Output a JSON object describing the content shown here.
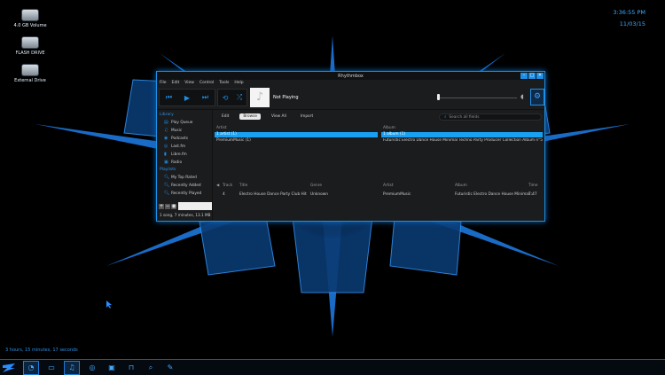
{
  "desktop": {
    "icons": [
      {
        "label": "4.0 GB Volume"
      },
      {
        "label": "FLASH DRIVE"
      },
      {
        "label": "External Drive"
      }
    ],
    "clock": {
      "time": "3:36:55 PM",
      "date": "11/03/15"
    },
    "uptime": "3 hours, 15 minutes, 17 seconds"
  },
  "taskbar": {
    "icons": [
      "start-logo-icon",
      "rhythmbox-icon",
      "monitor-icon",
      "music-icon",
      "settings-icon",
      "image-icon",
      "lock-icon",
      "search-icon",
      "tools-icon"
    ]
  },
  "window": {
    "title": "Rhythmbox",
    "controls": [
      "–",
      "□",
      "✕"
    ],
    "menu": [
      "File",
      "Edit",
      "View",
      "Control",
      "Tools",
      "Help"
    ],
    "now_playing": "Not Playing",
    "sidebar": {
      "library_header": "Library",
      "library_items": [
        "Play Queue",
        "Music",
        "Podcasts",
        "Last.fm",
        "Libre.fm",
        "Radio"
      ],
      "playlists_header": "Playlists",
      "playlist_items": [
        "My Top Rated",
        "Recently Added",
        "Recently Played"
      ]
    },
    "status": "1 song, 7 minutes, 13.1 MB",
    "tabs": [
      "Edit",
      "Browse",
      "View All",
      "Import"
    ],
    "search_placeholder": "Search all fields",
    "artist_header": "Artist",
    "album_header": "Album",
    "artist_rows": [
      "1 artist (1)",
      "PremiumMusic (1)"
    ],
    "album_rows": [
      "1 album (1)",
      "Futuristic Electro Dance House Minimal Techno Party Producer Collection Album n°5 (1)"
    ],
    "track_columns": [
      "Track",
      "Title",
      "Genre",
      "Artist",
      "Album",
      "Time"
    ],
    "tracks": [
      {
        "track": "4",
        "title": "Electro House Dance Party Club Hit",
        "genre": "Unknown",
        "artist": "PremiumMusic",
        "album": "Futuristic Electro Dance House Minimal...",
        "time": "7:47"
      }
    ]
  }
}
